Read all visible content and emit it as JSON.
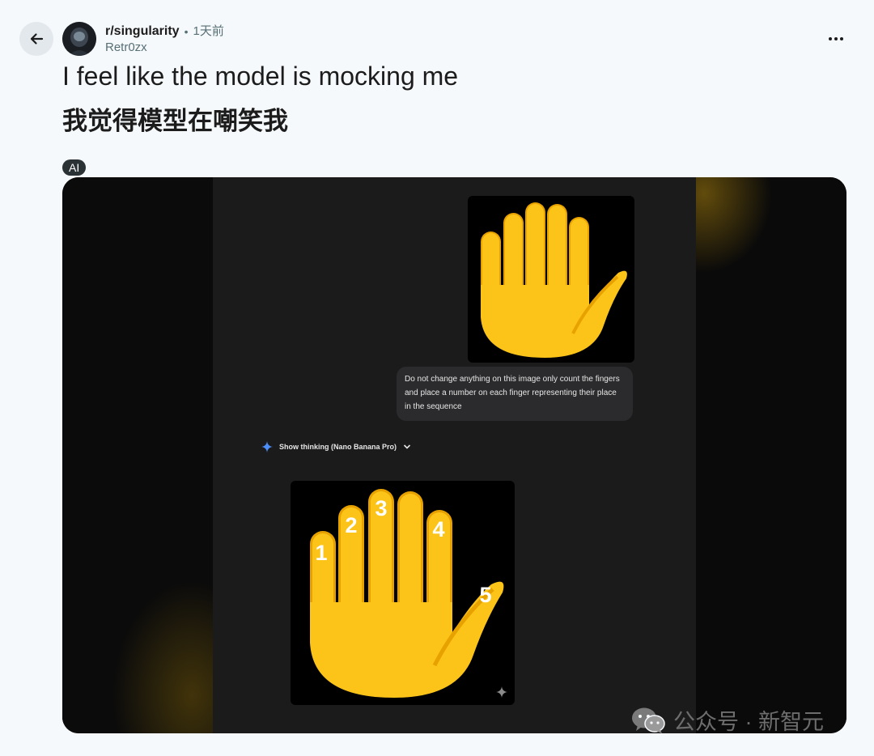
{
  "header": {
    "subreddit": "r/singularity",
    "separator": "•",
    "time": "1天前",
    "author": "Retr0zx"
  },
  "post": {
    "title_en": "I feel like the model is mocking me",
    "title_zh": "我觉得模型在嘲笑我",
    "flair": "AI"
  },
  "media": {
    "prompt_text": "Do not change anything on this image only count the fingers and place a number on each finger representing their place in the sequence",
    "thinking_label": "Show thinking (Nano Banana Pro)",
    "finger_labels": [
      "1",
      "2",
      "3",
      "4",
      "5"
    ]
  },
  "watermark": {
    "text": "公众号 · 新智元"
  },
  "icons": {
    "back": "arrow-left-icon",
    "more": "more-horizontal-icon",
    "sparkle": "gemini-sparkle-icon",
    "chevron": "chevron-down-icon",
    "watermark_logo": "wechat-icon"
  },
  "colors": {
    "page_bg": "#f6f9fb",
    "hand_yellow": "#fcc419",
    "hand_shadow": "#e8a200",
    "flair_bg": "#2a3236",
    "chat_bg": "#1b1b1c"
  }
}
